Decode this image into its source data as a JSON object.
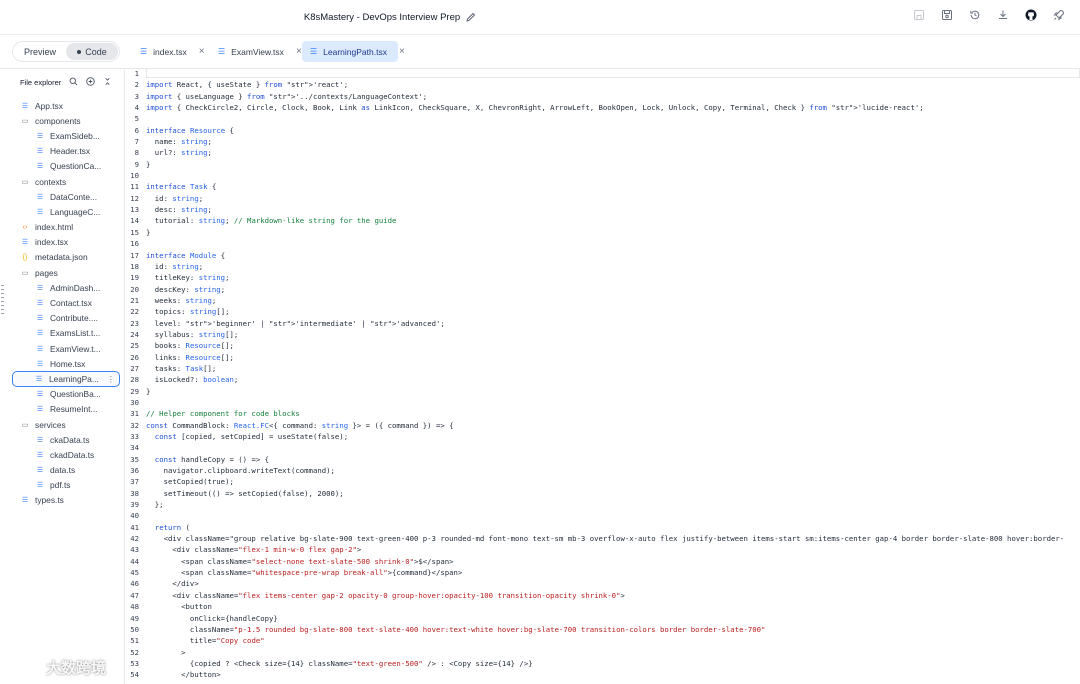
{
  "app": {
    "title": "K8sMastery - DevOps Interview Prep"
  },
  "top_icons": [
    "save-disabled-icon",
    "save-icon",
    "history-icon",
    "download-icon",
    "github-icon",
    "rocket-icon"
  ],
  "view_toggle": {
    "preview_label": "Preview",
    "code_label": "Code"
  },
  "tabs": [
    {
      "label": "index.tsx"
    },
    {
      "label": "ExamView.tsx"
    },
    {
      "label": "LearningPath.tsx"
    }
  ],
  "sidebar": {
    "header": "File explorer",
    "items": [
      {
        "label": "App.tsx",
        "kind": "file",
        "level": 0
      },
      {
        "label": "components",
        "kind": "folder",
        "level": 0
      },
      {
        "label": "ExamSideb...",
        "kind": "file",
        "level": 1
      },
      {
        "label": "Header.tsx",
        "kind": "file",
        "level": 1
      },
      {
        "label": "QuestionCa...",
        "kind": "file",
        "level": 1
      },
      {
        "label": "contexts",
        "kind": "folder",
        "level": 0
      },
      {
        "label": "DataConte...",
        "kind": "file",
        "level": 1
      },
      {
        "label": "LanguageC...",
        "kind": "file",
        "level": 1
      },
      {
        "label": "index.html",
        "kind": "html",
        "level": 0
      },
      {
        "label": "index.tsx",
        "kind": "file",
        "level": 0
      },
      {
        "label": "metadata.json",
        "kind": "json",
        "level": 0
      },
      {
        "label": "pages",
        "kind": "folder",
        "level": 0
      },
      {
        "label": "AdminDash...",
        "kind": "file",
        "level": 1
      },
      {
        "label": "Contact.tsx",
        "kind": "file",
        "level": 1
      },
      {
        "label": "Contribute....",
        "kind": "file",
        "level": 1
      },
      {
        "label": "ExamsList.t...",
        "kind": "file",
        "level": 1
      },
      {
        "label": "ExamView.t...",
        "kind": "file",
        "level": 1
      },
      {
        "label": "Home.tsx",
        "kind": "file",
        "level": 1
      },
      {
        "label": "LearningPa...",
        "kind": "file",
        "level": 1,
        "selected": true
      },
      {
        "label": "QuestionBa...",
        "kind": "file",
        "level": 1
      },
      {
        "label": "ResumeInt...",
        "kind": "file",
        "level": 1
      },
      {
        "label": "services",
        "kind": "folder",
        "level": 0
      },
      {
        "label": "ckaData.ts",
        "kind": "file",
        "level": 1
      },
      {
        "label": "ckadData.ts",
        "kind": "file",
        "level": 1
      },
      {
        "label": "data.ts",
        "kind": "file",
        "level": 1
      },
      {
        "label": "pdf.ts",
        "kind": "file",
        "level": 1
      },
      {
        "label": "types.ts",
        "kind": "file",
        "level": 0
      }
    ]
  },
  "code_lines": [
    "",
    "import React, { useState } from 'react';",
    "import { useLanguage } from '../contexts/LanguageContext';",
    "import { CheckCircle2, Circle, Clock, Book, Link as LinkIcon, CheckSquare, X, ChevronRight, ArrowLeft, BookOpen, Lock, Unlock, Copy, Terminal, Check } from 'lucide-react';",
    "",
    "interface Resource {",
    "  name: string;",
    "  url?: string;",
    "}",
    "",
    "interface Task {",
    "  id: string;",
    "  desc: string;",
    "  tutorial: string; // Markdown-like string for the guide",
    "}",
    "",
    "interface Module {",
    "  id: string;",
    "  titleKey: string;",
    "  descKey: string;",
    "  weeks: string;",
    "  topics: string[];",
    "  level: 'beginner' | 'intermediate' | 'advanced';",
    "  syllabus: string[];",
    "  books: Resource[];",
    "  links: Resource[];",
    "  tasks: Task[];",
    "  isLocked?: boolean;",
    "}",
    "",
    "// Helper component for code blocks",
    "const CommandBlock: React.FC<{ command: string }> = ({ command }) => {",
    "  const [copied, setCopied] = useState(false);",
    "",
    "  const handleCopy = () => {",
    "    navigator.clipboard.writeText(command);",
    "    setCopied(true);",
    "    setTimeout(() => setCopied(false), 2000);",
    "  };",
    "",
    "  return (",
    "    <div className=\"group relative bg-slate-900 text-green-400 p-3 rounded-md font-mono text-sm mb-3 overflow-x-auto flex justify-between items-start sm:items-center gap-4 border border-slate-800 hover:border-",
    "      <div className=\"flex-1 min-w-0 flex gap-2\">",
    "        <span className=\"select-none text-slate-500 shrink-0\">$</span>",
    "        <span className=\"whitespace-pre-wrap break-all\">{command}</span>",
    "      </div>",
    "      <div className=\"flex items-center gap-2 opacity-0 group-hover:opacity-100 transition-opacity shrink-0\">",
    "        <button",
    "          onClick={handleCopy}",
    "          className=\"p-1.5 rounded bg-slate-800 text-slate-400 hover:text-white hover:bg-slate-700 transition-colors border border-slate-700\"",
    "          title=\"Copy code\"",
    "        >",
    "          {copied ? <Check size={14} className=\"text-green-500\" /> : <Copy size={14} />}",
    "        </button>"
  ],
  "watermark": {
    "text": "大数跨境"
  }
}
